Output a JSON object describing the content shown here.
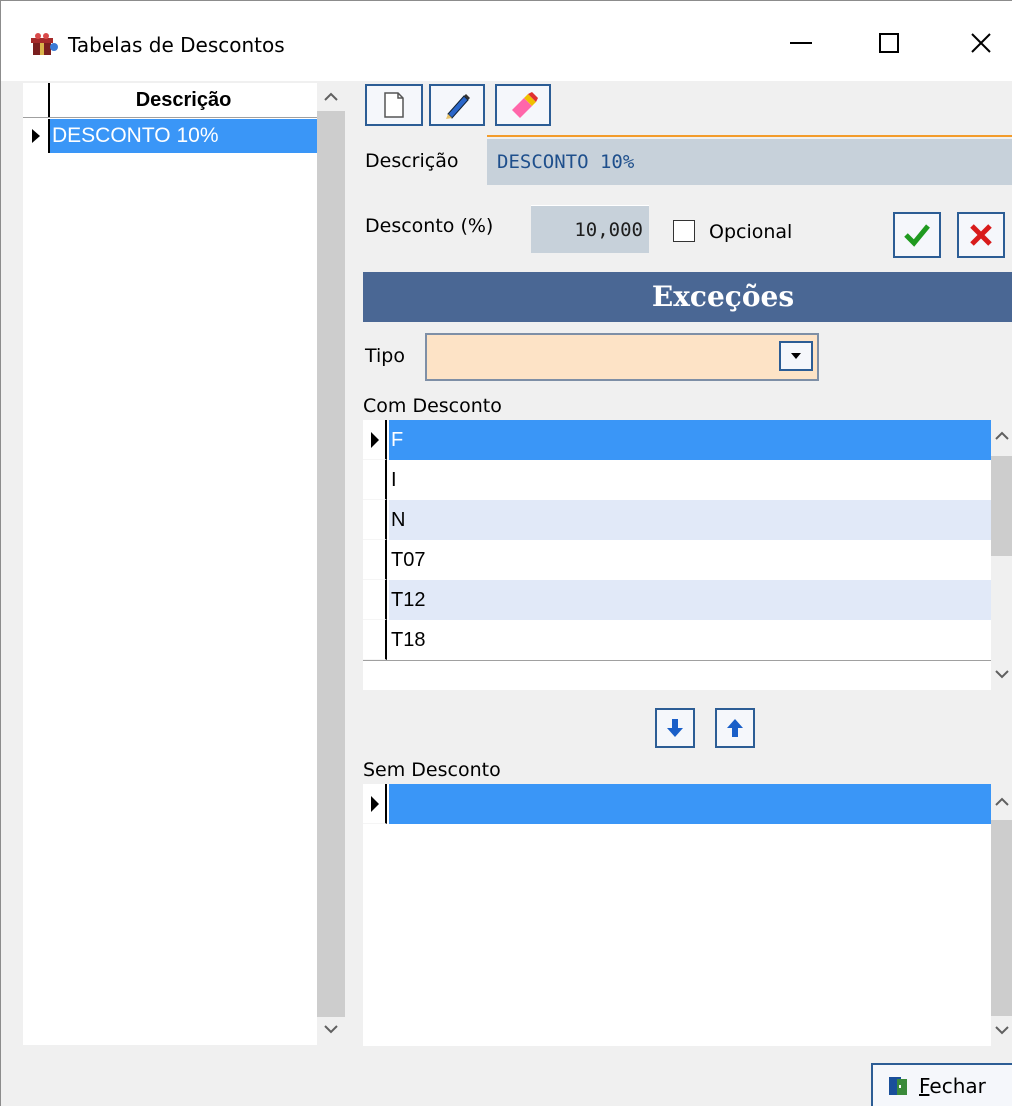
{
  "window": {
    "title": "Tabelas de Descontos",
    "icon": "app-gift-icon"
  },
  "left_grid": {
    "header": "Descrição",
    "rows": [
      "DESCONTO 10%"
    ]
  },
  "toolbar": {
    "buttons": [
      "new-document-icon",
      "edit-pen-icon",
      "eraser-icon"
    ]
  },
  "form": {
    "descricao_label": "Descrição",
    "descricao_value": "DESCONTO 10%",
    "desconto_label": "Desconto (%)",
    "desconto_value": "10,000",
    "opcional_label": "Opcional",
    "opcional_checked": false
  },
  "excecoes": {
    "title": "Exceções",
    "tipo_label": "Tipo",
    "tipo_value": "",
    "com_desconto_label": "Com Desconto",
    "com_desconto_rows": [
      "F",
      "I",
      "N",
      "T07",
      "T12",
      "T18"
    ],
    "sem_desconto_label": "Sem Desconto",
    "sem_desconto_rows": [
      ""
    ]
  },
  "footer": {
    "fechar_prefix": "F",
    "fechar_rest": "echar"
  },
  "colors": {
    "selection": "#3a96f7",
    "header_bar": "#4a6794",
    "tipo_bg": "#fde3c6",
    "accent_orange": "#f39c2b"
  }
}
